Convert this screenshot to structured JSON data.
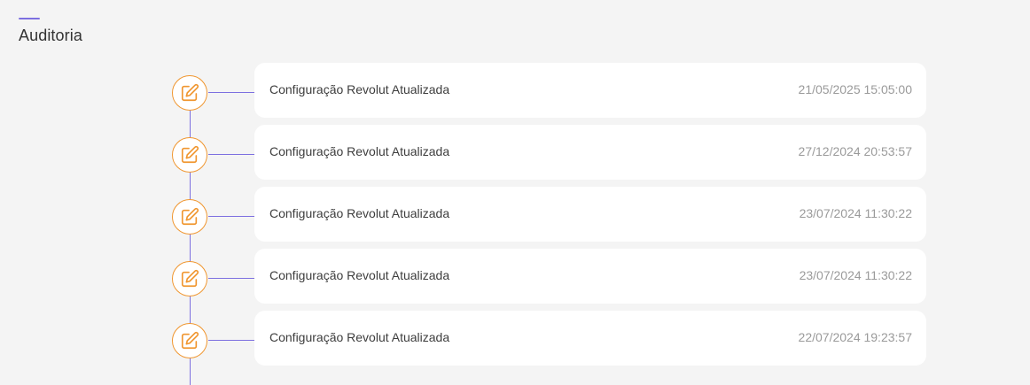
{
  "page": {
    "title": "Auditoria"
  },
  "colors": {
    "accent": "#7c6fe0",
    "icon": "#f0962f",
    "background": "#f4f4f4",
    "card": "#ffffff"
  },
  "timeline": {
    "entries": [
      {
        "icon": "edit-icon",
        "label": "Configuração Revolut Atualizada",
        "date": "21/05/2025 15:05:00"
      },
      {
        "icon": "edit-icon",
        "label": "Configuração Revolut Atualizada",
        "date": "27/12/2024 20:53:57"
      },
      {
        "icon": "edit-icon",
        "label": "Configuração Revolut Atualizada",
        "date": "23/07/2024 11:30:22"
      },
      {
        "icon": "edit-icon",
        "label": "Configuração Revolut Atualizada",
        "date": "23/07/2024 11:30:22"
      },
      {
        "icon": "edit-icon",
        "label": "Configuração Revolut Atualizada",
        "date": "22/07/2024 19:23:57"
      }
    ]
  }
}
